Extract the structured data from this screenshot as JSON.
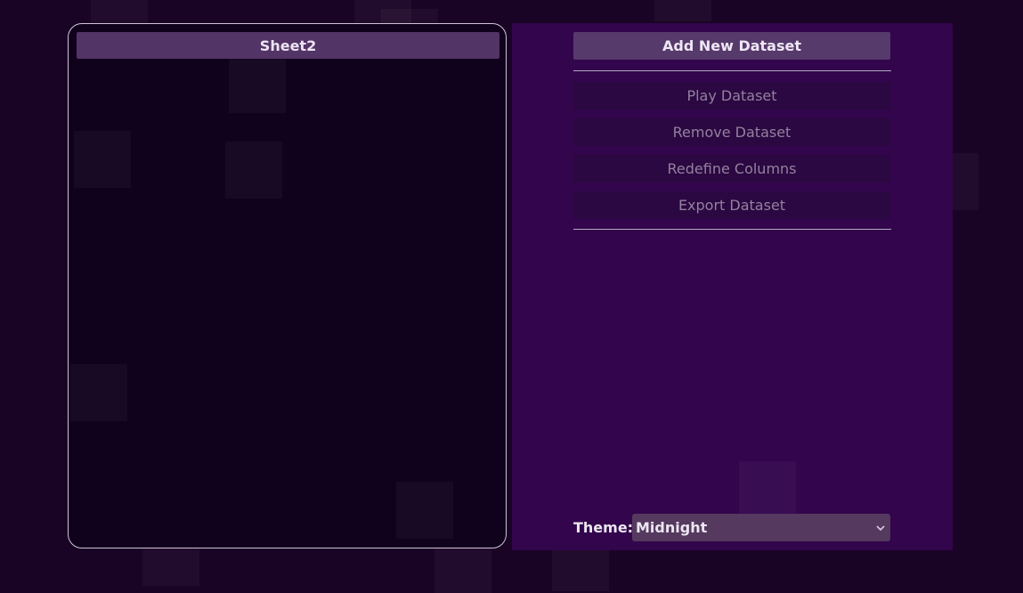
{
  "workspace": {
    "active_sheet": "Sheet2"
  },
  "actions": {
    "add_new_dataset": "Add New Dataset",
    "play_dataset": "Play Dataset",
    "remove_dataset": "Remove Dataset",
    "redefine_columns": "Redefine Columns",
    "export_dataset": "Export Dataset"
  },
  "theme": {
    "label": "Theme:",
    "selected": "Midnight"
  },
  "icons": {
    "dropdown": "chevron-down-icon"
  },
  "colors": {
    "background": "#1a0426",
    "left_panel": "#10011c",
    "right_panel": "#32054c",
    "primary_button": "#573a6c",
    "disabled_button": "#2b0841"
  }
}
